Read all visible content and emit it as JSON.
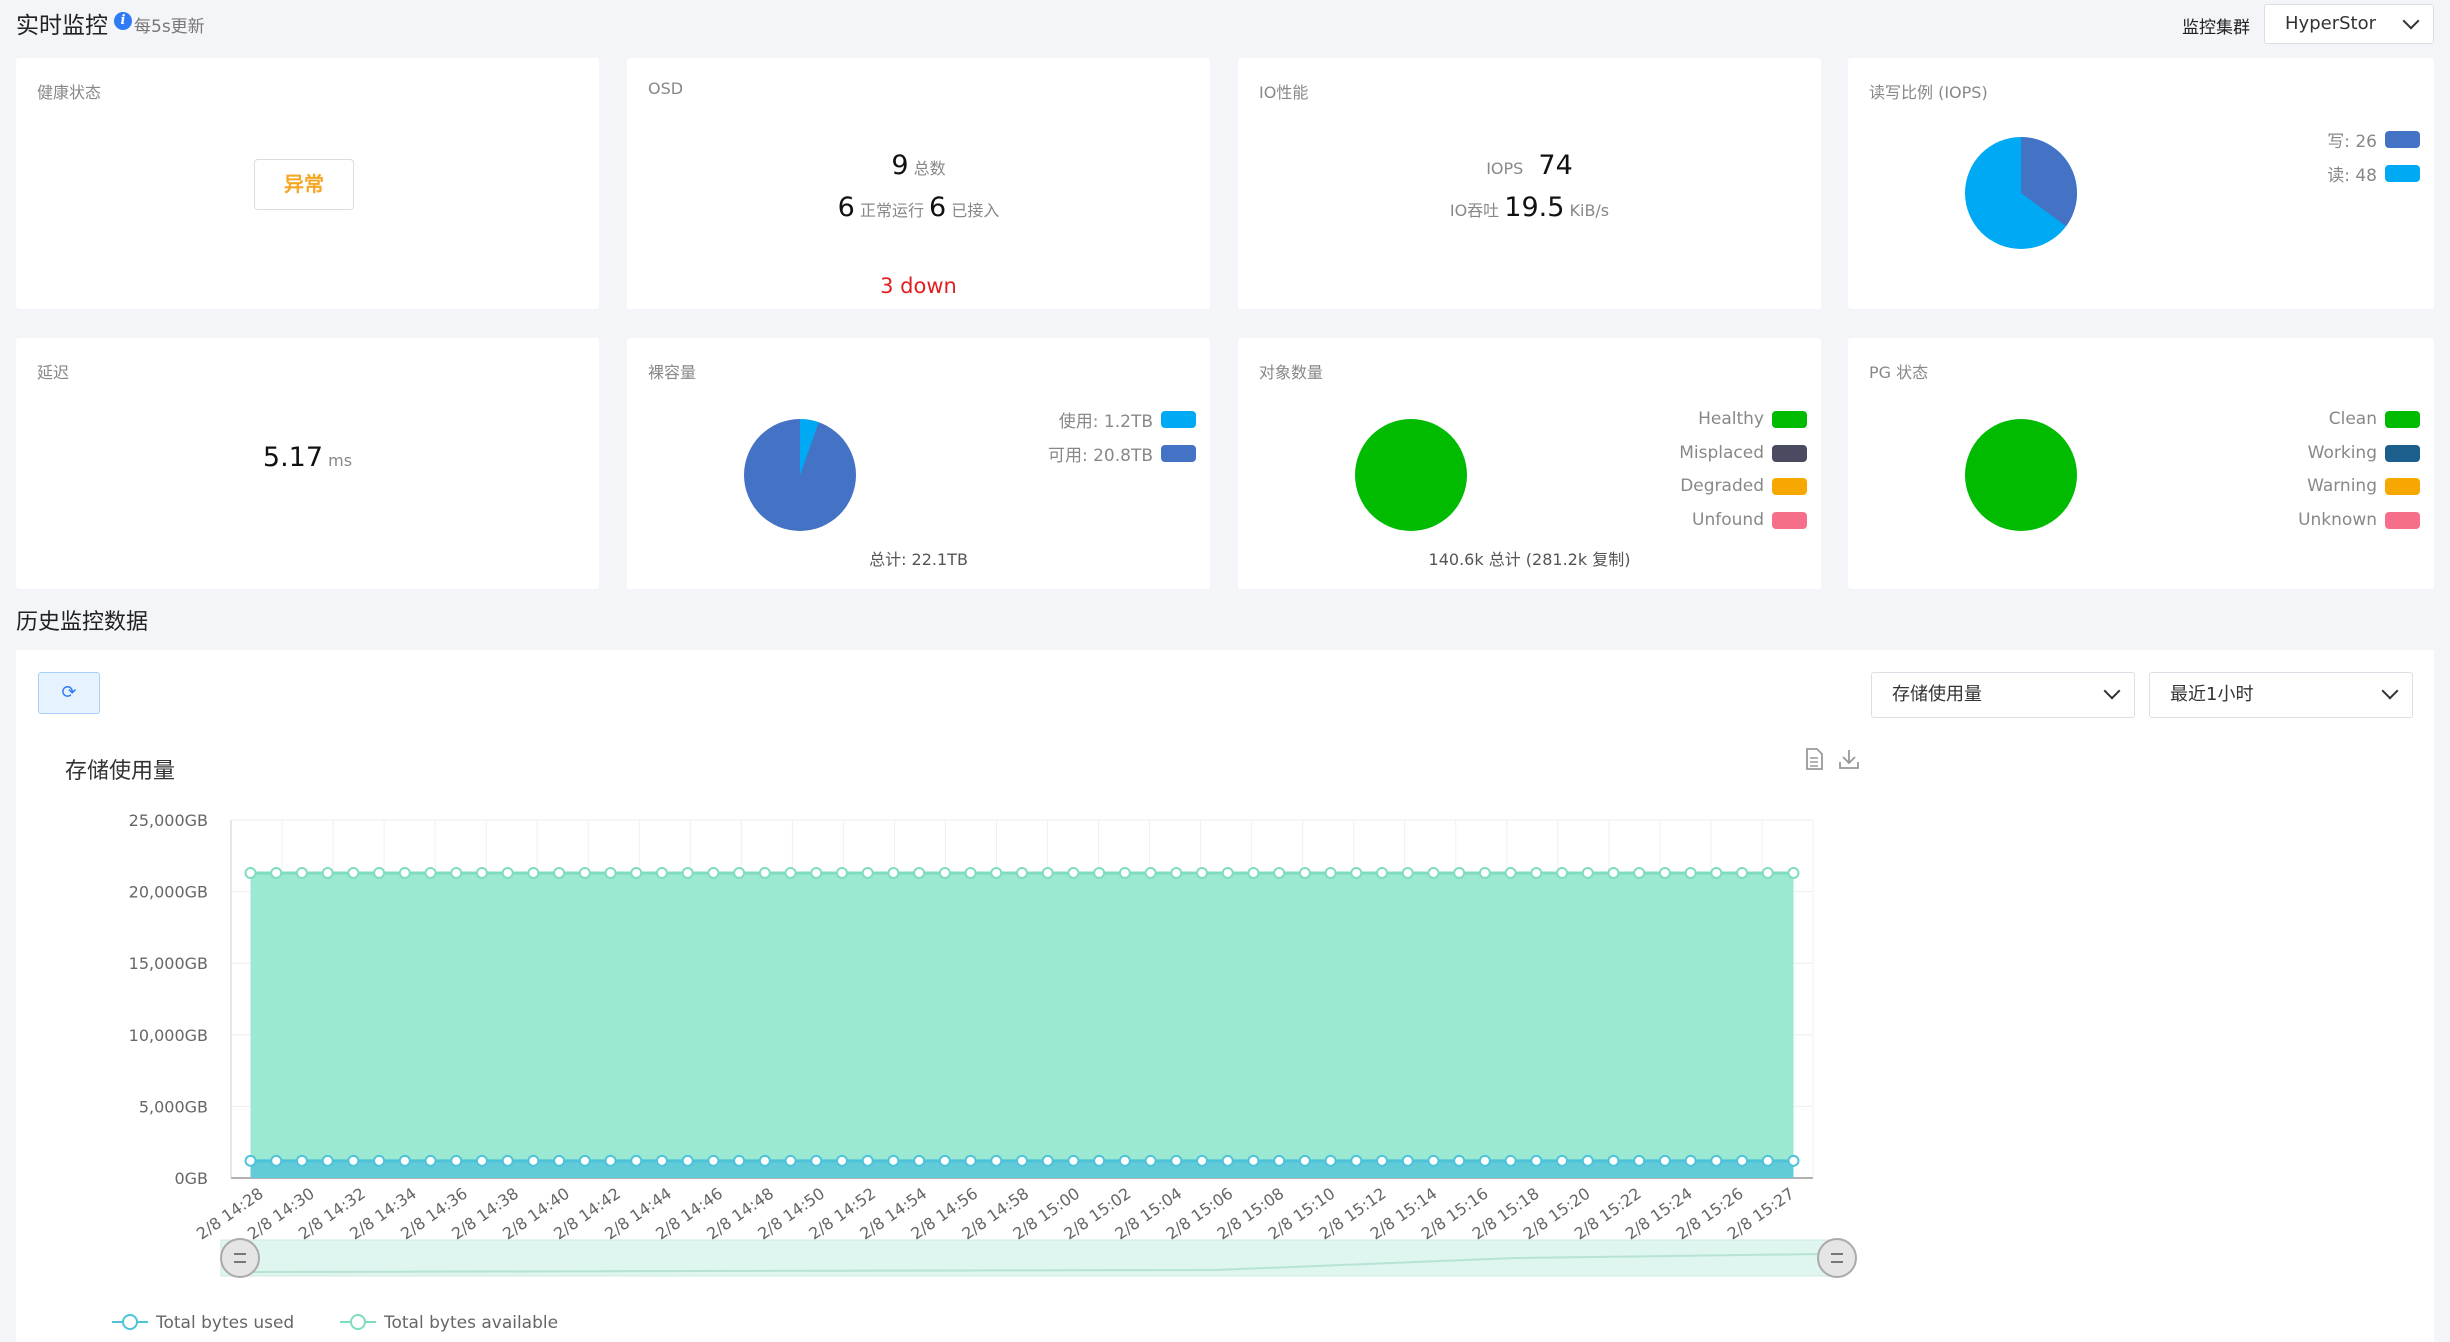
{
  "header": {
    "title": "实时监控",
    "info_icon": "info-icon",
    "update_note": "每5s更新",
    "cluster_label": "监控集群",
    "cluster_value": "HyperStor"
  },
  "cards": {
    "health": {
      "title": "健康状态",
      "status": "异常",
      "status_color": "#f5a623"
    },
    "osd": {
      "title": "OSD",
      "total": "9",
      "total_label": "总数",
      "running": "6",
      "running_label": "正常运行",
      "in": "6",
      "in_label": "已接入",
      "down": "3 down",
      "down_color": "#e02020"
    },
    "io": {
      "title": "IO性能",
      "iops_label": "IOPS",
      "iops_value": "74",
      "throughput_label": "IO吞吐",
      "throughput_value": "19.5",
      "throughput_unit": "KiB/s"
    },
    "rw": {
      "title": "读写比例 (IOPS)",
      "legend": [
        {
          "label": "写: 26",
          "color": "#4472c4",
          "value": 26
        },
        {
          "label": "读: 48",
          "color": "#00a9f4",
          "value": 48
        }
      ]
    },
    "latency": {
      "title": "延迟",
      "value": "5.17",
      "unit": "ms"
    },
    "capacity": {
      "title": "裸容量",
      "legend": [
        {
          "label": "使用: 1.2TB",
          "color": "#00a9f4",
          "value": 1.2
        },
        {
          "label": "可用: 20.8TB",
          "color": "#4472c4",
          "value": 20.8
        }
      ],
      "total": "总计: 22.1TB"
    },
    "objects": {
      "title": "对象数量",
      "legend": [
        {
          "label": "Healthy",
          "color": "#00bb00"
        },
        {
          "label": "Misplaced",
          "color": "#4a4a60"
        },
        {
          "label": "Degraded",
          "color": "#f7a800"
        },
        {
          "label": "Unfound",
          "color": "#f56f8a"
        }
      ],
      "total": "140.6k 总计 (281.2k 复制)"
    },
    "pg": {
      "title": "PG 状态",
      "legend": [
        {
          "label": "Clean",
          "color": "#00bb00"
        },
        {
          "label": "Working",
          "color": "#1c5e8c"
        },
        {
          "label": "Warning",
          "color": "#f7a800"
        },
        {
          "label": "Unknown",
          "color": "#f56f8a"
        }
      ]
    }
  },
  "history": {
    "title": "历史监控数据",
    "refresh_icon": "refresh-icon",
    "metric_select": "存储使用量",
    "range_select": "最近1小时",
    "doc_icon": "document-icon",
    "download_icon": "download-icon"
  },
  "chart_data": {
    "type": "area",
    "title": "存储使用量",
    "y_ticks": [
      "25,000GB",
      "20,000GB",
      "15,000GB",
      "10,000GB",
      "5,000GB",
      "0GB"
    ],
    "ylim": [
      0,
      25000
    ],
    "x": [
      "2/8 14:28",
      "2/8 14:30",
      "2/8 14:32",
      "2/8 14:34",
      "2/8 14:36",
      "2/8 14:38",
      "2/8 14:40",
      "2/8 14:42",
      "2/8 14:44",
      "2/8 14:46",
      "2/8 14:48",
      "2/8 14:50",
      "2/8 14:52",
      "2/8 14:54",
      "2/8 14:56",
      "2/8 14:58",
      "2/8 15:00",
      "2/8 15:02",
      "2/8 15:04",
      "2/8 15:06",
      "2/8 15:08",
      "2/8 15:10",
      "2/8 15:12",
      "2/8 15:14",
      "2/8 15:16",
      "2/8 15:18",
      "2/8 15:20",
      "2/8 15:22",
      "2/8 15:24",
      "2/8 15:26",
      "2/8 15:27"
    ],
    "series": [
      {
        "name": "Total bytes used",
        "color": "#4cc3d9",
        "fill": "#5fc9d8",
        "value": 1200,
        "points": 61
      },
      {
        "name": "Total bytes available",
        "color": "#7fdcc0",
        "fill": "#96e8d0",
        "value": 21300,
        "points": 61
      }
    ],
    "grid": true,
    "legend_position": "bottom-left",
    "zoom_slider": true
  }
}
